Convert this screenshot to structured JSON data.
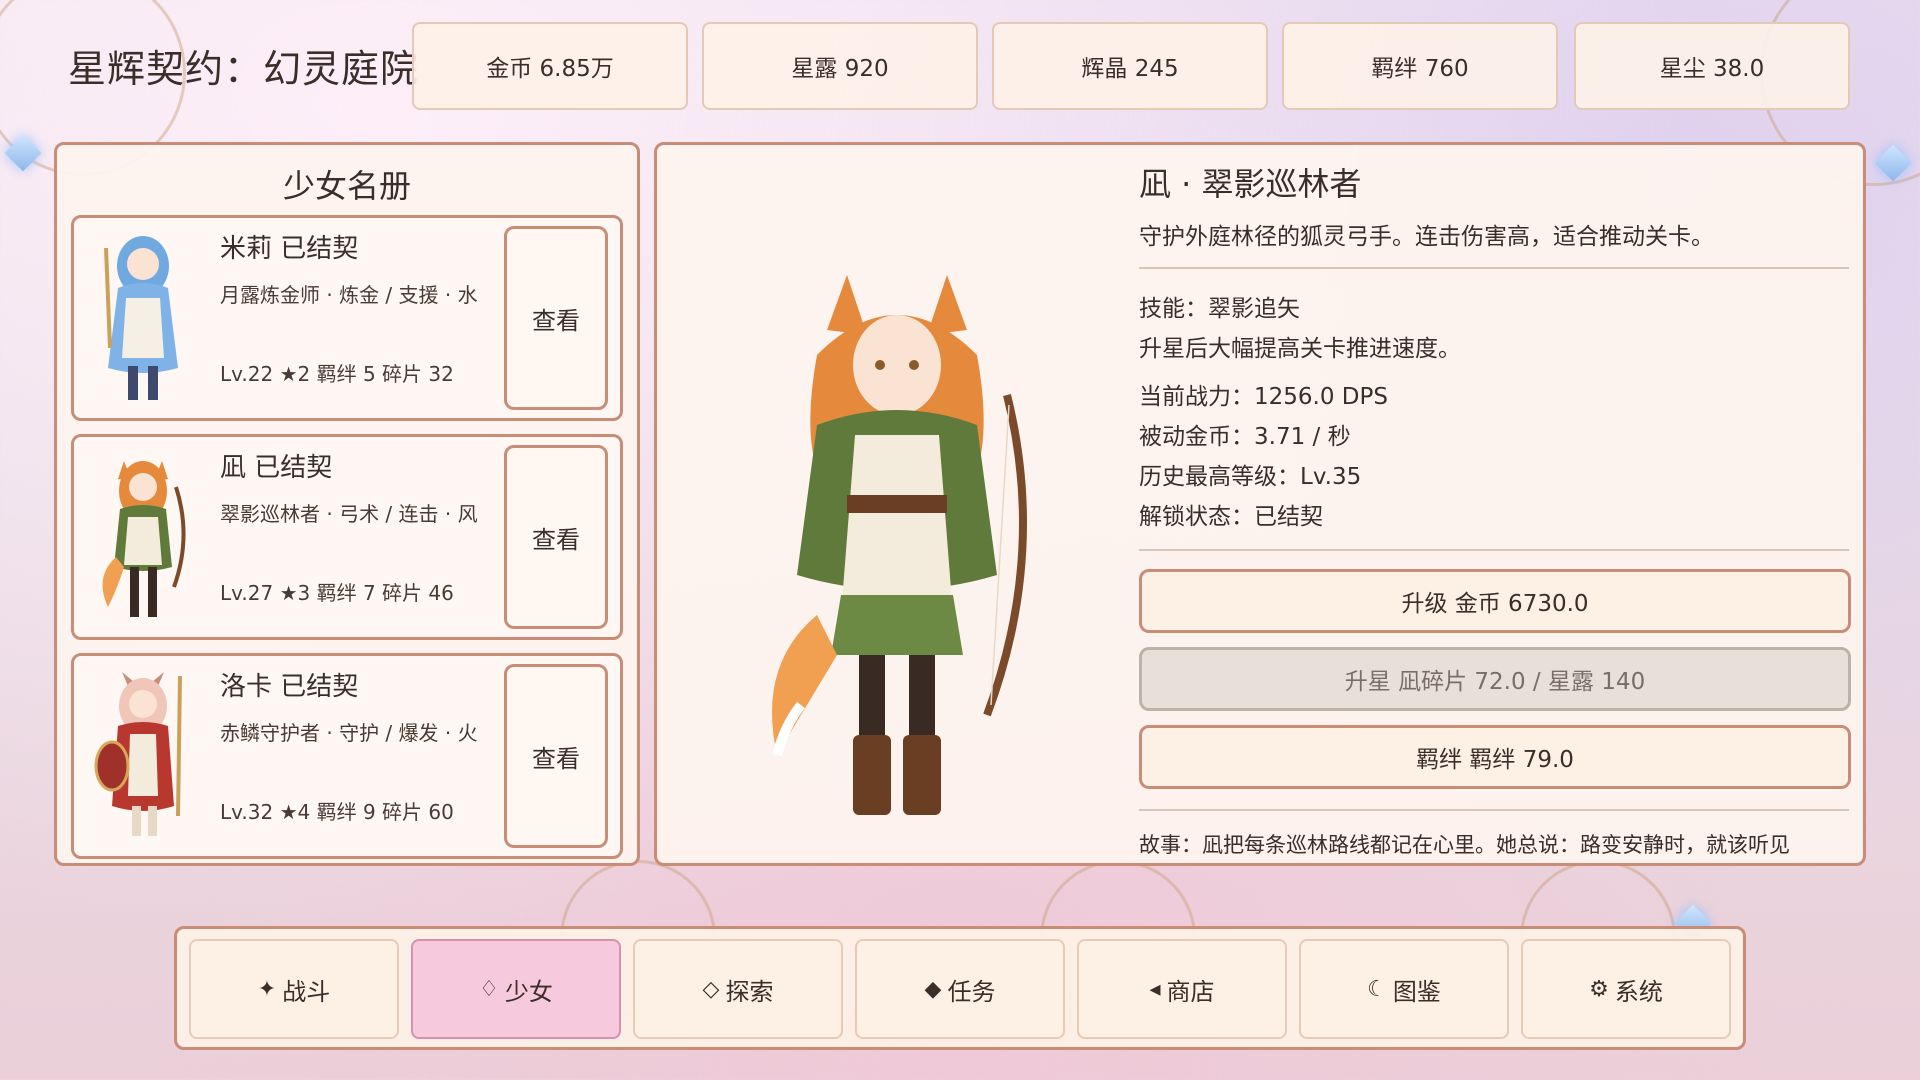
{
  "title": "星辉契约：幻灵庭院",
  "resources": [
    {
      "label": "金币 6.85万"
    },
    {
      "label": "星露 920"
    },
    {
      "label": "辉晶 245"
    },
    {
      "label": "羁绊 760"
    },
    {
      "label": "星尘 38.0"
    }
  ],
  "roster": {
    "title": "少女名册",
    "cards": [
      {
        "name": "米莉  已结契",
        "sub": "月露炼金师 · 炼金 / 支援 · 水",
        "stats": "Lv.22 ★2 羁绊 5 碎片 32",
        "button": "查看",
        "hair": "#6fa9e0",
        "outfit": "#7fb3e8"
      },
      {
        "name": "凪  已结契",
        "sub": "翠影巡林者 · 弓术 / 连击 · 风",
        "stats": "Lv.27 ★3 羁绊 7 碎片 46",
        "button": "查看",
        "hair": "#e58a3c",
        "outfit": "#5f7a3a"
      },
      {
        "name": "洛卡  已结契",
        "sub": "赤鳞守护者 · 守护 / 爆发 · 火",
        "stats": "Lv.32 ★4 羁绊 9 碎片 60",
        "button": "查看",
        "hair": "#f0c6b8",
        "outfit": "#b8372e"
      }
    ]
  },
  "detail": {
    "name": "凪 · 翠影巡林者",
    "description": "守护外庭林径的狐灵弓手。连击伤害高，适合推动关卡。",
    "skill": "技能：翠影追矢",
    "skill_desc": "升星后大幅提高关卡推进速度。",
    "power": "当前战力：1256.0 DPS",
    "passive_gold": "被动金币：3.71 / 秒",
    "max_level": "历史最高等级：Lv.35",
    "unlock": "解锁状态：已结契",
    "upgrade_btn": "升级  金币 6730.0",
    "star_btn": "升星  凪碎片 72.0 / 星露 140",
    "bond_btn": "羁绊  羁绊 79.0",
    "story": "故事：凪把每条巡林路线都记在心里。她总说：路变安静时，就该听见"
  },
  "nav": [
    {
      "icon": "✦",
      "label": "战斗",
      "icon_name": "sparkle-icon",
      "active": false
    },
    {
      "icon": "♢",
      "label": "少女",
      "icon_name": "diamond-outline-icon",
      "active": true
    },
    {
      "icon": "◇",
      "label": "探索",
      "icon_name": "diamond-icon",
      "active": false
    },
    {
      "icon": "◆",
      "label": "任务",
      "icon_name": "diamond-filled-icon",
      "active": false
    },
    {
      "icon": "◂",
      "label": "商店",
      "icon_name": "shop-icon",
      "active": false
    },
    {
      "icon": "☾",
      "label": "图鉴",
      "icon_name": "moon-icon",
      "active": false
    },
    {
      "icon": "⚙",
      "label": "系统",
      "icon_name": "gear-icon",
      "active": false
    }
  ]
}
